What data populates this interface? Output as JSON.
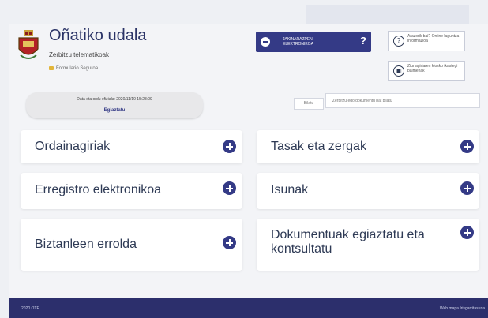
{
  "header": {
    "org_name": "Oñatiko udala",
    "org_subtitle": "Zerbitzu telematikoak",
    "lock_text": "Formulario Seguroa"
  },
  "sede": {
    "label": "JAKINARAZPEN ELEKTRONIKOA",
    "help": "?"
  },
  "info_links": {
    "help_text": "Arazorik bai? Online laguntza informazioa",
    "browser_text": "Ziurtagiriaren kiosko ikastegi baimenak"
  },
  "date_box": {
    "text": "Data eta ordu ofiziala: 2020/11/10 15:28:09",
    "link": "Egiaztatu"
  },
  "search": {
    "label": "Bilatu",
    "placeholder": "Zerbitzu edo dokumentu bat bilatu"
  },
  "cards": [
    {
      "label": "Ordainagiriak"
    },
    {
      "label": "Tasak eta zergak"
    },
    {
      "label": "Erregistro elektronikoa"
    },
    {
      "label": "Isunak"
    },
    {
      "label": "Biztanleen errolda"
    },
    {
      "label": "Dokumentuak egiaztatu eta kontsultatu"
    }
  ],
  "footer": {
    "left": "2020 OTE",
    "right": "Web mapa  Irisgarritasuna"
  },
  "colors": {
    "accent": "#343a86",
    "footer": "#2c2f6c",
    "background": "#eef0f4"
  }
}
